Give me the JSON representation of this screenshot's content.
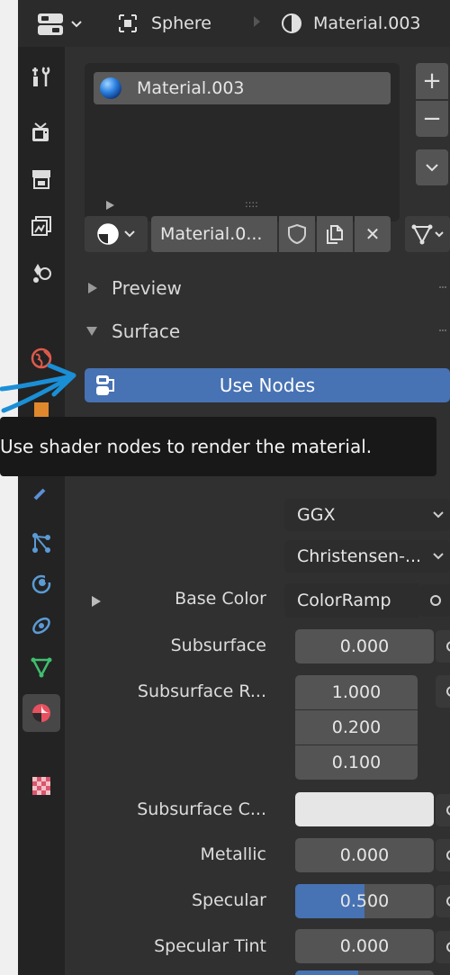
{
  "header": {
    "object_name": "Sphere",
    "material_name": "Material.003"
  },
  "material_slots": {
    "items": [
      {
        "label": "Material.003"
      }
    ],
    "add_symbol": "+",
    "remove_symbol": "−",
    "grip": "::::"
  },
  "datablock": {
    "name": "Material.0...",
    "close_symbol": "✕"
  },
  "sections": {
    "preview": "Preview",
    "surface": "Surface"
  },
  "use_nodes_button": "Use Nodes",
  "tooltip": "Use shader nodes to render the material.",
  "shader": {
    "distribution": "GGX",
    "subsurface_method": "Christensen-...",
    "properties": [
      {
        "label": "Base Color",
        "value": "ColorRamp"
      },
      {
        "label": "Subsurface",
        "value": "0.000"
      },
      {
        "label": "Subsurface R...",
        "values": [
          "1.000",
          "0.200",
          "0.100"
        ]
      },
      {
        "label": "Subsurface C...",
        "value": ""
      },
      {
        "label": "Metallic",
        "value": "0.000"
      },
      {
        "label": "Specular",
        "value": "0.500",
        "fraction": 0.5
      },
      {
        "label": "Specular Tint",
        "value": "0.000"
      }
    ]
  },
  "colors": {
    "accent": "#4772b3",
    "subsurface_color": "#e6e6e6",
    "annotation_arrow": "#1a8fd6"
  }
}
